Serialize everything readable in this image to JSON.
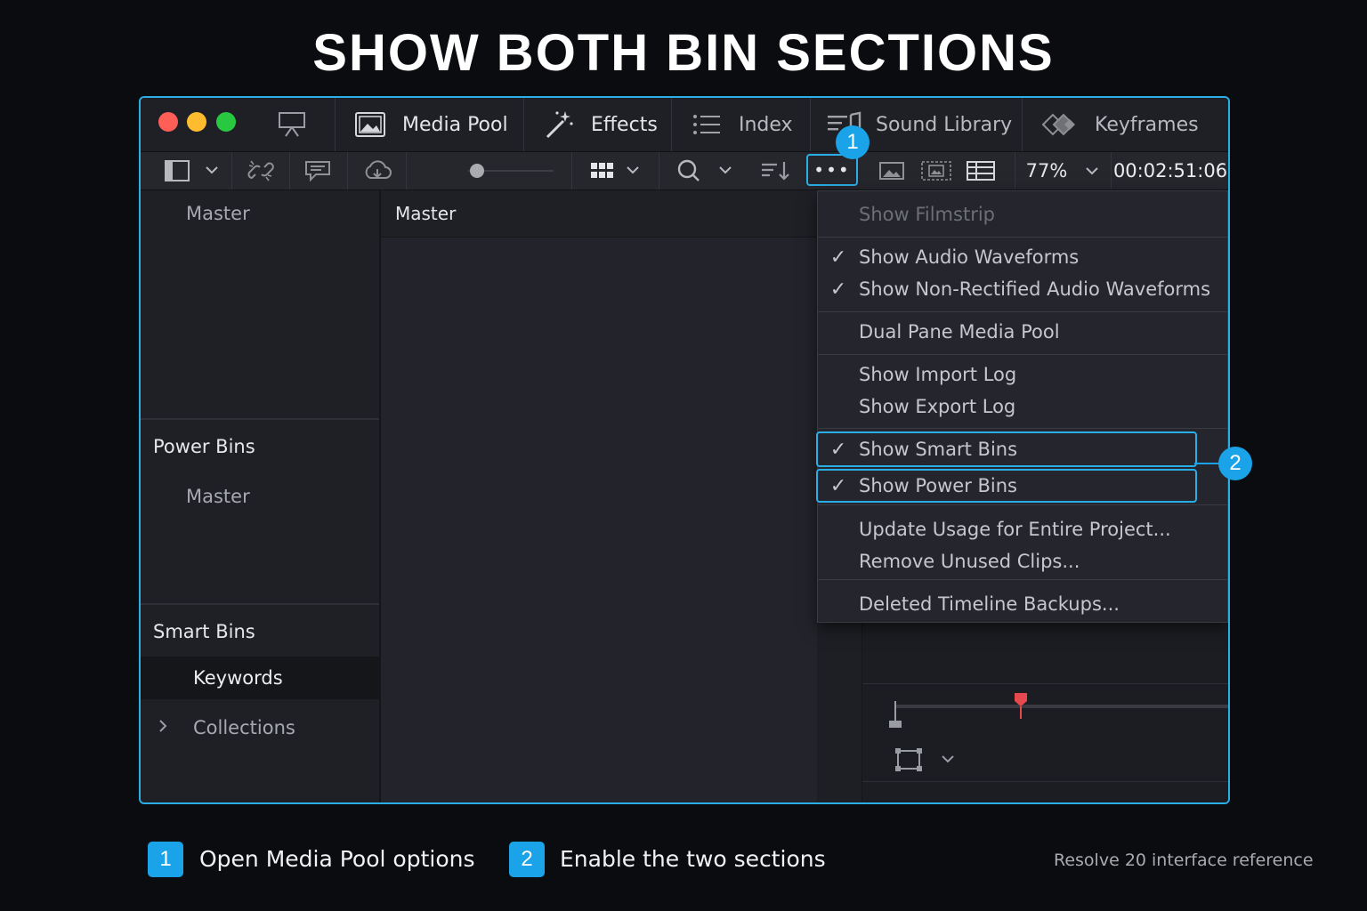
{
  "headline": "SHOW BOTH BIN SECTIONS",
  "tabs": [
    {
      "label": "Media Pool",
      "icon": "image-icon"
    },
    {
      "label": "Effects",
      "icon": "magic-wand-icon"
    },
    {
      "label": "Index",
      "icon": "list-icon"
    },
    {
      "label": "Sound Library",
      "icon": "sound-library-icon"
    },
    {
      "label": "Keyframes",
      "icon": "keyframes-icon"
    }
  ],
  "toolbar": {
    "zoom": "77%",
    "timecode": "00:02:51:06",
    "more_button": "•••"
  },
  "sidebar": {
    "master_top": "Master",
    "power_bins_heading": "Power Bins",
    "power_bins_master": "Master",
    "smart_bins_heading": "Smart Bins",
    "keywords": "Keywords",
    "collections": "Collections"
  },
  "center": {
    "heading": "Master"
  },
  "menu": {
    "items": [
      {
        "label": "Show Filmstrip",
        "checked": false,
        "disabled": true
      },
      {
        "label": "Show Audio Waveforms",
        "checked": true
      },
      {
        "label": "Show Non-Rectified Audio Waveforms",
        "checked": true
      },
      {
        "label": "Dual Pane Media Pool",
        "checked": false
      },
      {
        "label": "Show Import Log",
        "checked": false
      },
      {
        "label": "Show Export Log",
        "checked": false
      },
      {
        "label": "Show Smart Bins",
        "checked": true
      },
      {
        "label": "Show Power Bins",
        "checked": true
      },
      {
        "label": "Update Usage for Entire Project...",
        "checked": false
      },
      {
        "label": "Remove Unused Clips...",
        "checked": false
      },
      {
        "label": "Deleted Timeline Backups...",
        "checked": false
      }
    ],
    "check_glyph": "✓"
  },
  "callouts": {
    "one": "1",
    "two": "2"
  },
  "steps": [
    {
      "num": "1",
      "text": "Open Media Pool options"
    },
    {
      "num": "2",
      "text": "Enable the two sections"
    }
  ],
  "footnote": "Resolve 20 interface reference",
  "colors": {
    "accent": "#1aa3e8",
    "close": "#ff5f57",
    "minimize": "#febc2e",
    "zoom": "#28c840",
    "playhead": "#e5484d"
  }
}
